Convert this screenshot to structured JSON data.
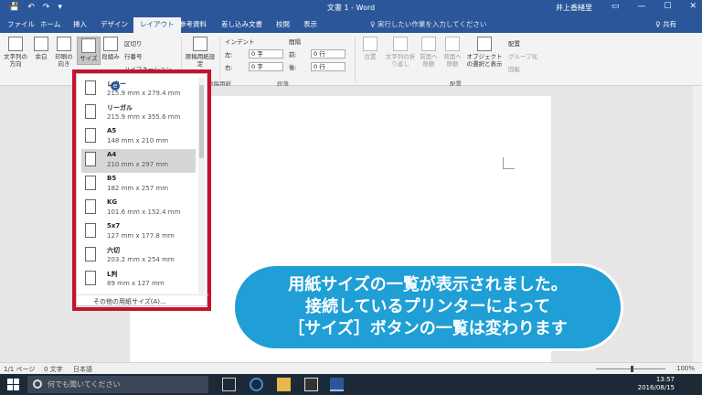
{
  "titlebar": {
    "title": "文書 1 - Word",
    "user": "井上香緒里",
    "qat": [
      "💾",
      "↶",
      "↷",
      "▾"
    ],
    "win": [
      "▭",
      "—",
      "☐",
      "✕"
    ]
  },
  "tabs": [
    "ファイル",
    "ホーム",
    "挿入",
    "デザイン",
    "レイアウト",
    "参考資料",
    "差し込み文書",
    "校閲",
    "表示"
  ],
  "active_tab": "レイアウト",
  "tellme": "♀ 実行したい作業を入力してください",
  "share": "♀ 共有",
  "ribbon": {
    "text_direction": "文字列の方向",
    "margins": "余白",
    "orientation": "印刷の向き",
    "size": "サイズ",
    "columns": "段組み",
    "breaks": "区切り",
    "line_numbers": "行番号",
    "hyphenation": "ハイフネーション",
    "manuscript": "原稿用紙設定",
    "manuscript_group": "原稿用紙",
    "indent_label": "インデント",
    "spacing_label": "間隔",
    "indent_left_label": "左:",
    "indent_right_label": "右:",
    "space_before_label": "前:",
    "space_after_label": "後:",
    "indent_left": "0 字",
    "indent_right": "0 字",
    "space_before": "0 行",
    "space_after": "0 行",
    "paragraph_group": "段落",
    "position": "位置",
    "wrap": "文字列の折り返し",
    "bring_forward": "前面へ移動",
    "send_backward": "背面へ移動",
    "selection_pane": "オブジェクトの選択と表示",
    "align": "配置",
    "group": "グループ化",
    "rotate": "回転",
    "arrange_group": "配置"
  },
  "paper_sizes": [
    {
      "name": "レター",
      "dims": "215.9 mm x 279.4 mm"
    },
    {
      "name": "リーガル",
      "dims": "215.9 mm x 355.6 mm"
    },
    {
      "name": "A5",
      "dims": "148 mm x 210 mm"
    },
    {
      "name": "A4",
      "dims": "210 mm x 297 mm"
    },
    {
      "name": "B5",
      "dims": "182 mm x 257 mm"
    },
    {
      "name": "KG",
      "dims": "101.6 mm x 152.4 mm"
    },
    {
      "name": "5x7",
      "dims": "127 mm x 177.8 mm"
    },
    {
      "name": "六切",
      "dims": "203.2 mm x 254 mm"
    },
    {
      "name": "L判",
      "dims": "89 mm x 127 mm"
    }
  ],
  "selected_paper": "A4",
  "more_sizes": "その他の用紙サイズ(A)...",
  "callout": {
    "line1": "用紙サイズの一覧が表示されました。",
    "line2": "接続しているプリンターによって",
    "line3": "［サイズ］ボタンの一覧は変わります"
  },
  "status": {
    "page": "1/1 ページ",
    "words": "0 文字",
    "lang": "日本語",
    "zoom": "100%",
    "zoom_level_percent": 100
  },
  "taskbar": {
    "search_placeholder": "何でも聞いてください",
    "time": "13:57",
    "date": "2016/08/15"
  }
}
